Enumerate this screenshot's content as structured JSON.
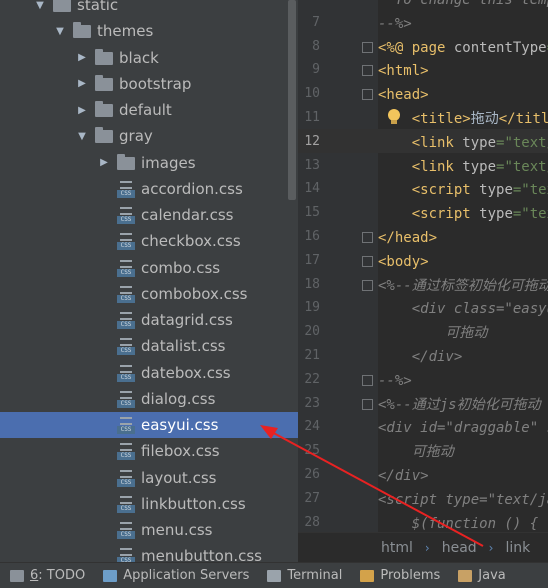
{
  "tree": [
    {
      "label": "static",
      "depth": 1,
      "arrow": "down",
      "icon": "folder"
    },
    {
      "label": "themes",
      "depth": 2,
      "arrow": "down",
      "icon": "folder"
    },
    {
      "label": "black",
      "depth": 3,
      "arrow": "right",
      "icon": "folder"
    },
    {
      "label": "bootstrap",
      "depth": 3,
      "arrow": "right",
      "icon": "folder"
    },
    {
      "label": "default",
      "depth": 3,
      "arrow": "right",
      "icon": "folder"
    },
    {
      "label": "gray",
      "depth": 3,
      "arrow": "down",
      "icon": "folder"
    },
    {
      "label": "images",
      "depth": 4,
      "arrow": "right",
      "icon": "folder"
    },
    {
      "label": "accordion.css",
      "depth": 4,
      "icon": "css"
    },
    {
      "label": "calendar.css",
      "depth": 4,
      "icon": "css"
    },
    {
      "label": "checkbox.css",
      "depth": 4,
      "icon": "css"
    },
    {
      "label": "combo.css",
      "depth": 4,
      "icon": "css"
    },
    {
      "label": "combobox.css",
      "depth": 4,
      "icon": "css"
    },
    {
      "label": "datagrid.css",
      "depth": 4,
      "icon": "css"
    },
    {
      "label": "datalist.css",
      "depth": 4,
      "icon": "css"
    },
    {
      "label": "datebox.css",
      "depth": 4,
      "icon": "css"
    },
    {
      "label": "dialog.css",
      "depth": 4,
      "icon": "css"
    },
    {
      "label": "easyui.css",
      "depth": 4,
      "icon": "css",
      "selected": true
    },
    {
      "label": "filebox.css",
      "depth": 4,
      "icon": "css"
    },
    {
      "label": "layout.css",
      "depth": 4,
      "icon": "css"
    },
    {
      "label": "linkbutton.css",
      "depth": 4,
      "icon": "css"
    },
    {
      "label": "menu.css",
      "depth": 4,
      "icon": "css"
    },
    {
      "label": "menubutton.css",
      "depth": 4,
      "icon": "css"
    }
  ],
  "css_badge": "CSS",
  "editor": {
    "current_line": 12,
    "lines": [
      {
        "n": "",
        "segs": [
          {
            "t": "  To change this template",
            "c": "cm"
          }
        ]
      },
      {
        "n": "7",
        "segs": [
          {
            "t": "--%>",
            "c": "cm"
          }
        ]
      },
      {
        "n": "8",
        "segs": [
          {
            "t": "<%@ ",
            "c": "tg"
          },
          {
            "t": "page ",
            "c": "tg"
          },
          {
            "t": "contentType",
            "c": "at"
          },
          {
            "t": "=\"text",
            "c": "vl"
          }
        ]
      },
      {
        "n": "9",
        "segs": [
          {
            "t": "<html>",
            "c": "tg"
          }
        ]
      },
      {
        "n": "10",
        "segs": [
          {
            "t": "<head>",
            "c": "tg"
          }
        ]
      },
      {
        "n": "11",
        "segs": [
          {
            "t": "    "
          },
          {
            "t": "<title>",
            "c": "tg"
          },
          {
            "t": "拖动"
          },
          {
            "t": "</title>",
            "c": "tg"
          }
        ]
      },
      {
        "n": "12",
        "segs": [
          {
            "t": "    "
          },
          {
            "t": "<link ",
            "c": "tg"
          },
          {
            "t": "type",
            "c": "at"
          },
          {
            "t": "=\"text/css",
            "c": "vl"
          }
        ]
      },
      {
        "n": "13",
        "segs": [
          {
            "t": "    "
          },
          {
            "t": "<link ",
            "c": "tg"
          },
          {
            "t": "type",
            "c": "at"
          },
          {
            "t": "=\"text/css",
            "c": "vl"
          }
        ]
      },
      {
        "n": "14",
        "segs": [
          {
            "t": "    "
          },
          {
            "t": "<script ",
            "c": "tg"
          },
          {
            "t": "type",
            "c": "at"
          },
          {
            "t": "=\"text/j",
            "c": "vl"
          }
        ]
      },
      {
        "n": "15",
        "segs": [
          {
            "t": "    "
          },
          {
            "t": "<script ",
            "c": "tg"
          },
          {
            "t": "type",
            "c": "at"
          },
          {
            "t": "=\"text/j",
            "c": "vl"
          }
        ]
      },
      {
        "n": "16",
        "segs": [
          {
            "t": "</head>",
            "c": "tg"
          }
        ]
      },
      {
        "n": "17",
        "segs": [
          {
            "t": "<body>",
            "c": "tg"
          }
        ]
      },
      {
        "n": "18",
        "segs": [
          {
            "t": "<%--通过标签初始化可拖动",
            "c": "cm"
          }
        ]
      },
      {
        "n": "19",
        "segs": [
          {
            "t": "    <div class=\"easyui-",
            "c": "cm"
          }
        ]
      },
      {
        "n": "20",
        "segs": [
          {
            "t": "        可拖动",
            "c": "cm"
          }
        ]
      },
      {
        "n": "21",
        "segs": [
          {
            "t": "    </div>",
            "c": "cm"
          }
        ]
      },
      {
        "n": "22",
        "segs": [
          {
            "t": "--%>",
            "c": "cm"
          }
        ]
      },
      {
        "n": "23",
        "segs": [
          {
            "t": "<%--通过js初始化可拖动",
            "c": "cm"
          }
        ]
      },
      {
        "n": "24",
        "segs": [
          {
            "t": "<div id=\"draggable\" st",
            "c": "cm"
          }
        ]
      },
      {
        "n": "25",
        "segs": [
          {
            "t": "    可拖动",
            "c": "cm"
          }
        ]
      },
      {
        "n": "26",
        "segs": [
          {
            "t": "</div>",
            "c": "cm"
          }
        ]
      },
      {
        "n": "27",
        "segs": [
          {
            "t": "<script type=\"text/jav",
            "c": "cm"
          }
        ]
      },
      {
        "n": "28",
        "segs": [
          {
            "t": "    $(function () {",
            "c": "cm"
          }
        ]
      }
    ]
  },
  "breadcrumb": [
    "html",
    "head",
    "link"
  ],
  "toolbar": [
    {
      "num": "6",
      "label": ": TODO",
      "name": "todo-tool-button"
    },
    {
      "label": "Application Servers",
      "name": "application-servers-tool-button"
    },
    {
      "label": "Terminal",
      "name": "terminal-tool-button"
    },
    {
      "label": "Problems",
      "name": "problems-tool-button"
    },
    {
      "label": "Java",
      "name": "java-tool-button"
    }
  ]
}
